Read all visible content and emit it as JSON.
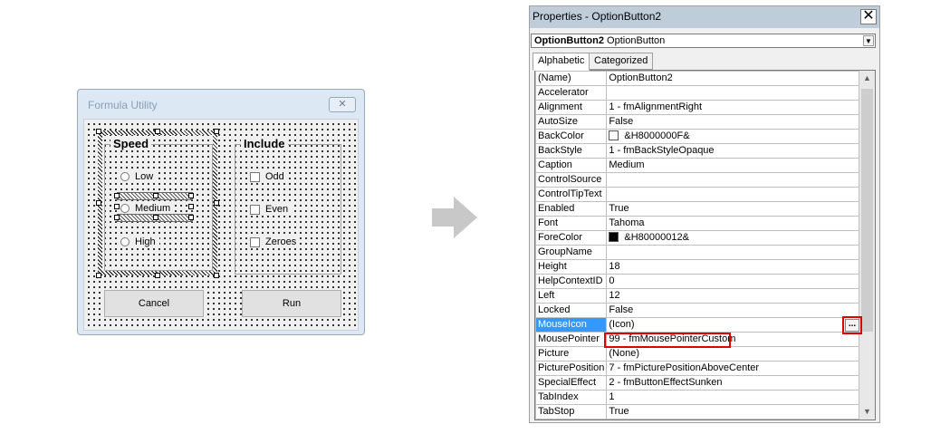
{
  "userform": {
    "title": "Formula Utility",
    "close_glyph": "✕",
    "frames": [
      {
        "caption": "Speed",
        "options": [
          "Low",
          "Medium",
          "High"
        ]
      },
      {
        "caption": "Include",
        "checkboxes": [
          "Odd",
          "Even",
          "Zeroes"
        ]
      }
    ],
    "buttons": {
      "cancel": "Cancel",
      "run": "Run"
    }
  },
  "properties": {
    "title": "Properties - OptionButton2",
    "close_glyph": "✕",
    "object_name": "OptionButton2",
    "object_type": "OptionButton",
    "tabs": [
      "Alphabetic",
      "Categorized"
    ],
    "active_tab": "Alphabetic",
    "selected_property": "MouseIcon",
    "ellipsis_label": "...",
    "rows": [
      {
        "name": "(Name)",
        "value": "OptionButton2"
      },
      {
        "name": "Accelerator",
        "value": ""
      },
      {
        "name": "Alignment",
        "value": "1 - fmAlignmentRight"
      },
      {
        "name": "AutoSize",
        "value": "False"
      },
      {
        "name": "BackColor",
        "value": "&H8000000F&",
        "swatch": "#ffffff"
      },
      {
        "name": "BackStyle",
        "value": "1 - fmBackStyleOpaque"
      },
      {
        "name": "Caption",
        "value": "Medium"
      },
      {
        "name": "ControlSource",
        "value": ""
      },
      {
        "name": "ControlTipText",
        "value": ""
      },
      {
        "name": "Enabled",
        "value": "True"
      },
      {
        "name": "Font",
        "value": "Tahoma"
      },
      {
        "name": "ForeColor",
        "value": "&H80000012&",
        "swatch": "#000000"
      },
      {
        "name": "GroupName",
        "value": ""
      },
      {
        "name": "Height",
        "value": "18"
      },
      {
        "name": "HelpContextID",
        "value": "0"
      },
      {
        "name": "Left",
        "value": "12"
      },
      {
        "name": "Locked",
        "value": "False"
      },
      {
        "name": "MouseIcon",
        "value": "(Icon)"
      },
      {
        "name": "MousePointer",
        "value": "99 - fmMousePointerCustom"
      },
      {
        "name": "Picture",
        "value": "(None)"
      },
      {
        "name": "PicturePosition",
        "value": "7 - fmPicturePositionAboveCenter"
      },
      {
        "name": "SpecialEffect",
        "value": "2 - fmButtonEffectSunken"
      },
      {
        "name": "TabIndex",
        "value": "1"
      },
      {
        "name": "TabStop",
        "value": "True"
      }
    ]
  }
}
